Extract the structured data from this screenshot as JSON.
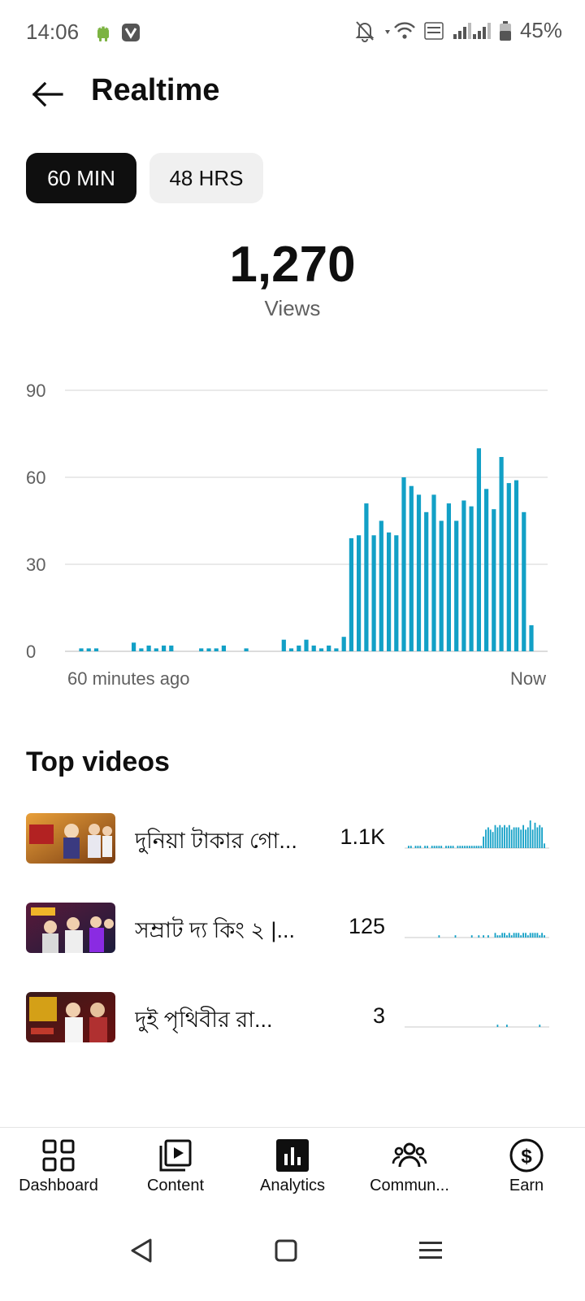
{
  "status": {
    "time": "14:06",
    "battery": "45%"
  },
  "header": {
    "title": "Realtime"
  },
  "chips": [
    {
      "label": "60 MIN",
      "active": true
    },
    {
      "label": "48 HRS",
      "active": false
    }
  ],
  "total": {
    "value": "1,270",
    "label": "Views"
  },
  "chart_data": {
    "type": "bar",
    "ylim": [
      0,
      90
    ],
    "yticks": [
      "90",
      "60",
      "30",
      "0"
    ],
    "x_start_label": "60 minutes ago",
    "x_end_label": "Now",
    "grid": true,
    "color": "#12a0c6",
    "values": [
      1,
      1,
      1,
      0,
      0,
      0,
      0,
      3,
      1,
      2,
      1,
      2,
      2,
      0,
      0,
      0,
      1,
      1,
      1,
      2,
      0,
      0,
      1,
      0,
      0,
      0,
      0,
      4,
      1,
      2,
      4,
      2,
      1,
      2,
      1,
      5,
      39,
      40,
      51,
      40,
      45,
      41,
      40,
      60,
      57,
      54,
      48,
      54,
      45,
      51,
      45,
      52,
      50,
      70,
      56,
      49,
      67,
      58,
      59,
      48,
      9
    ]
  },
  "top_videos": {
    "title": "Top videos",
    "items": [
      {
        "title": "দুনিয়া টাকার গো...",
        "views": "1.1K",
        "spark": [
          1,
          1,
          0,
          1,
          1,
          1,
          0,
          1,
          1,
          0,
          1,
          1,
          1,
          1,
          1,
          0,
          1,
          1,
          1,
          1,
          0,
          1,
          1,
          1,
          1,
          1,
          1,
          1,
          1,
          1,
          1,
          1,
          5,
          8,
          9,
          8,
          7,
          10,
          9,
          10,
          9,
          10,
          9,
          10,
          8,
          9,
          9,
          9,
          8,
          10,
          8,
          9,
          12,
          8,
          11,
          9,
          10,
          9,
          2
        ]
      },
      {
        "title": "সম্রাট দ্য কিং ২ |...",
        "views": "125",
        "spark": [
          0,
          0,
          0,
          0,
          0,
          0,
          0,
          0,
          0,
          0,
          0,
          0,
          0,
          1,
          0,
          0,
          0,
          0,
          0,
          0,
          1,
          0,
          0,
          0,
          0,
          0,
          0,
          1,
          0,
          0,
          1,
          0,
          1,
          0,
          1,
          0,
          0,
          2,
          1,
          1,
          2,
          2,
          1,
          2,
          1,
          2,
          2,
          2,
          1,
          2,
          2,
          1,
          2,
          2,
          2,
          2,
          1,
          2,
          1
        ]
      },
      {
        "title": "দুই পৃথিবীর রা...",
        "views": "3",
        "spark": [
          0,
          0,
          0,
          0,
          0,
          0,
          0,
          0,
          0,
          0,
          0,
          0,
          0,
          0,
          0,
          0,
          0,
          0,
          0,
          0,
          0,
          0,
          0,
          0,
          0,
          0,
          0,
          0,
          0,
          0,
          0,
          0,
          0,
          0,
          0,
          0,
          0,
          0,
          1,
          0,
          0,
          0,
          1,
          0,
          0,
          0,
          0,
          0,
          0,
          0,
          0,
          0,
          0,
          0,
          0,
          0,
          1,
          0,
          0
        ]
      }
    ]
  },
  "bottom_nav": [
    {
      "label": "Dashboard",
      "icon": "dashboard-icon"
    },
    {
      "label": "Content",
      "icon": "content-icon"
    },
    {
      "label": "Analytics",
      "icon": "analytics-icon"
    },
    {
      "label": "Commun...",
      "icon": "community-icon"
    },
    {
      "label": "Earn",
      "icon": "earn-icon"
    }
  ]
}
